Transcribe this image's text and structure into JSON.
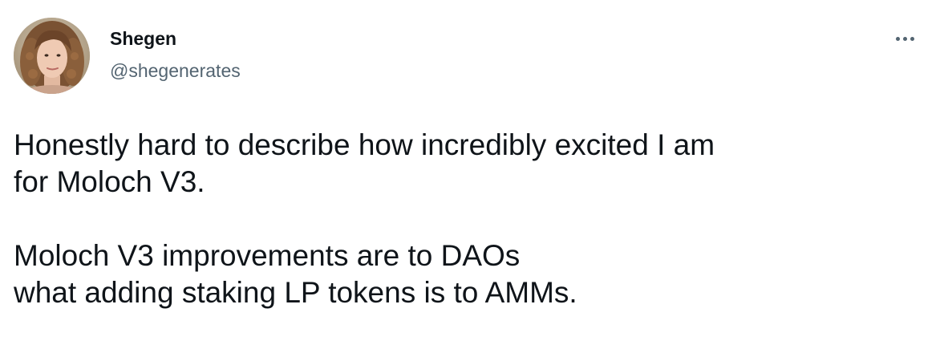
{
  "tweet": {
    "author": {
      "display_name": "Shegen",
      "handle": "@shegenerates",
      "avatar_icon": "profile-photo"
    },
    "more_icon": "more-options-icon",
    "text": {
      "paragraph1_line1": "Honestly hard to describe how incredibly excited I am",
      "paragraph1_line2": "for Moloch V3.",
      "paragraph2_line1": "Moloch V3 improvements are to DAOs",
      "paragraph2_line2": "what adding staking LP tokens is to AMMs."
    }
  },
  "colors": {
    "text_primary": "#0f1419",
    "text_secondary": "#536471",
    "background": "#ffffff"
  }
}
